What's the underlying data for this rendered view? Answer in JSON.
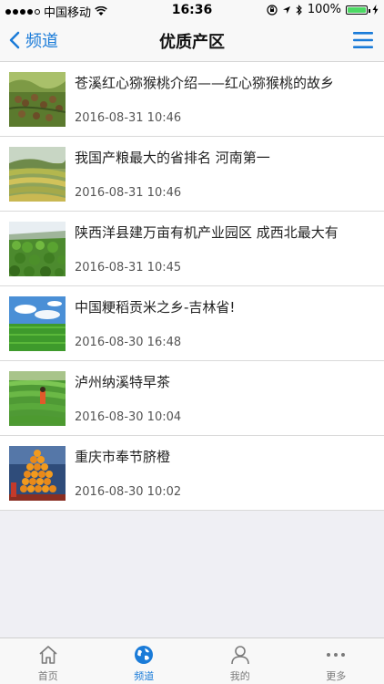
{
  "status_bar": {
    "carrier": "中国移动",
    "time": "16:36",
    "battery": "100%",
    "battery_level": 1.0
  },
  "nav": {
    "back_label": "频道",
    "title": "优质产区",
    "back_icon": "chevron-left-icon",
    "menu_icon": "hamburger-menu-icon",
    "accent_color": "#1a7bd8"
  },
  "articles": [
    {
      "title": "苍溪红心猕猴桃介绍——红心猕猴桃的故乡",
      "date": "2016-08-31 10:46",
      "thumb": "kiwi-orchard"
    },
    {
      "title": "我国产粮最大的省排名 河南第一",
      "date": "2016-08-31 10:46",
      "thumb": "terraced-fields"
    },
    {
      "title": "陕西洋县建万亩有机产业园区 成西北最大有",
      "date": "2016-08-31 10:45",
      "thumb": "green-crops"
    },
    {
      "title": "中国粳稻贡米之乡-吉林省!",
      "date": "2016-08-30 16:48",
      "thumb": "rice-field-sky"
    },
    {
      "title": "泸州纳溪特早茶",
      "date": "2016-08-30 10:04",
      "thumb": "tea-plantation"
    },
    {
      "title": "重庆市奉节脐橙",
      "date": "2016-08-30 10:02",
      "thumb": "orange-tower"
    }
  ],
  "tabs": [
    {
      "label": "首页",
      "icon": "home-icon",
      "active": false
    },
    {
      "label": "频道",
      "icon": "globe-icon",
      "active": true
    },
    {
      "label": "我的",
      "icon": "user-icon",
      "active": false
    },
    {
      "label": "更多",
      "icon": "more-icon",
      "active": false
    }
  ]
}
